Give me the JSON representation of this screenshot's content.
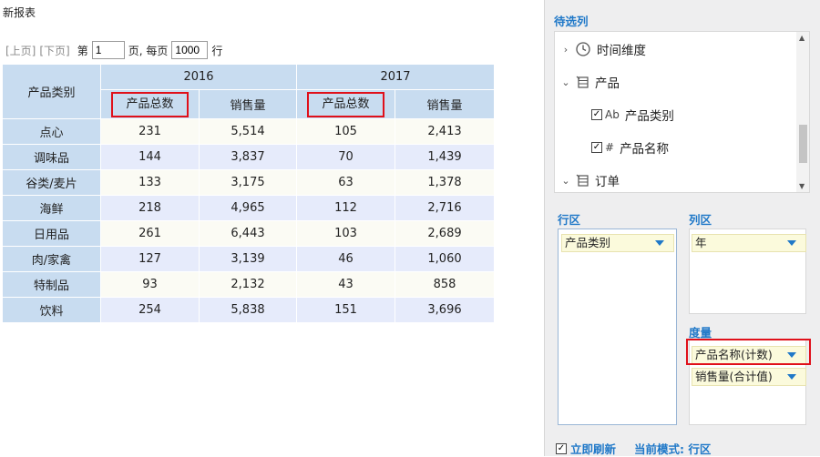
{
  "report": {
    "title": "新报表",
    "pager": {
      "prev": "[上页]",
      "next": "[下页]",
      "page_prefix": "第",
      "page_value": "1",
      "page_suffix": "页, 每页",
      "size_value": "1000",
      "size_suffix": "行"
    }
  },
  "table": {
    "row_header": "产品类别",
    "years": [
      "2016",
      "2017"
    ],
    "columns": [
      "产品总数",
      "销售量",
      "产品总数",
      "销售量"
    ],
    "rows": [
      {
        "category": "点心",
        "v": [
          "231",
          "5,514",
          "105",
          "2,413"
        ]
      },
      {
        "category": "调味品",
        "v": [
          "144",
          "3,837",
          "70",
          "1,439"
        ]
      },
      {
        "category": "谷类/麦片",
        "v": [
          "133",
          "3,175",
          "63",
          "1,378"
        ]
      },
      {
        "category": "海鲜",
        "v": [
          "218",
          "4,965",
          "112",
          "2,716"
        ]
      },
      {
        "category": "日用品",
        "v": [
          "261",
          "6,443",
          "103",
          "2,689"
        ]
      },
      {
        "category": "肉/家禽",
        "v": [
          "127",
          "3,139",
          "46",
          "1,060"
        ]
      },
      {
        "category": "特制品",
        "v": [
          "93",
          "2,132",
          "43",
          "858"
        ]
      },
      {
        "category": "饮料",
        "v": [
          "254",
          "5,838",
          "151",
          "3,696"
        ]
      }
    ]
  },
  "panel": {
    "candidates_title": "待选列",
    "tree": [
      {
        "label": "时间维度",
        "icon": "clock-icon"
      },
      {
        "label": "产品",
        "icon": "table-icon"
      },
      {
        "label": "产品类别",
        "icon": "text-field-icon",
        "type_glyph": "Ab"
      },
      {
        "label": "产品名称",
        "icon": "number-field-icon",
        "type_glyph": "#"
      },
      {
        "label": "订单",
        "icon": "table-icon"
      }
    ],
    "row_zone_title": "行区",
    "row_zone_items": [
      "产品类别"
    ],
    "col_zone_title": "列区",
    "col_zone_items": [
      "年"
    ],
    "measure_title": "度量",
    "measure_items": [
      "产品名称(计数)",
      "销售量(合计值)"
    ],
    "refresh_label": "立即刷新",
    "mode_label": "当前模式: 行区"
  },
  "colors": {
    "accent": "#1f78c8",
    "header_bg": "#c8dcf0",
    "highlight": "#e0101a"
  }
}
